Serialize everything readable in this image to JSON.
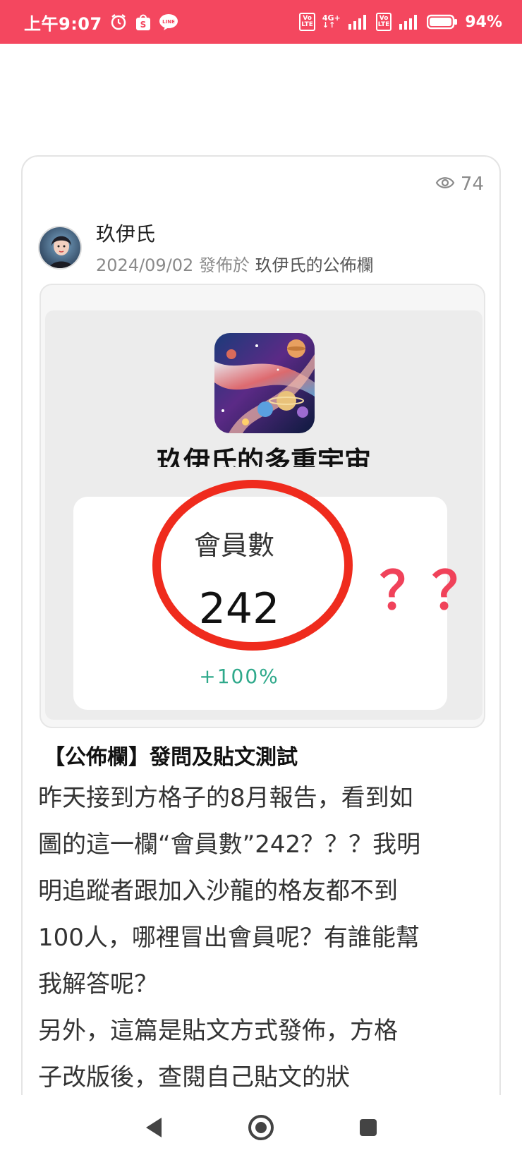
{
  "status_bar": {
    "time": "上午9:07",
    "icons": [
      "alarm-icon",
      "shopee-icon",
      "line-icon"
    ],
    "badges": [
      "Vo LTE",
      "4G+",
      "Vo LTE"
    ],
    "battery": "94%"
  },
  "post": {
    "views": "74",
    "author_name": "玖伊氏",
    "date": "2024/09/02",
    "published_in_label": "發佈於",
    "board_name": "玖伊氏的公佈欄",
    "image": {
      "salon_title": "玖伊氏的多重宇宙",
      "stat_label": "會員數",
      "stat_value": "242",
      "stat_change": "+100%",
      "annotation": "？？"
    },
    "title": "【公佈欄】發問及貼文測試",
    "body_lines": [
      "昨天接到方格子的8月報告，看到如",
      "圖的這一欄“會員數”242？？？我明",
      "明追蹤者跟加入沙龍的格友都不到",
      "100人，哪裡冒出會員呢？有誰能幫",
      "我解答呢？",
      "另外，這篇是貼文方式發佈，方格",
      "子改版後，查閱自己貼文的狀"
    ]
  },
  "nav": {
    "back": "back-icon",
    "home": "home-icon",
    "recents": "recents-icon"
  }
}
